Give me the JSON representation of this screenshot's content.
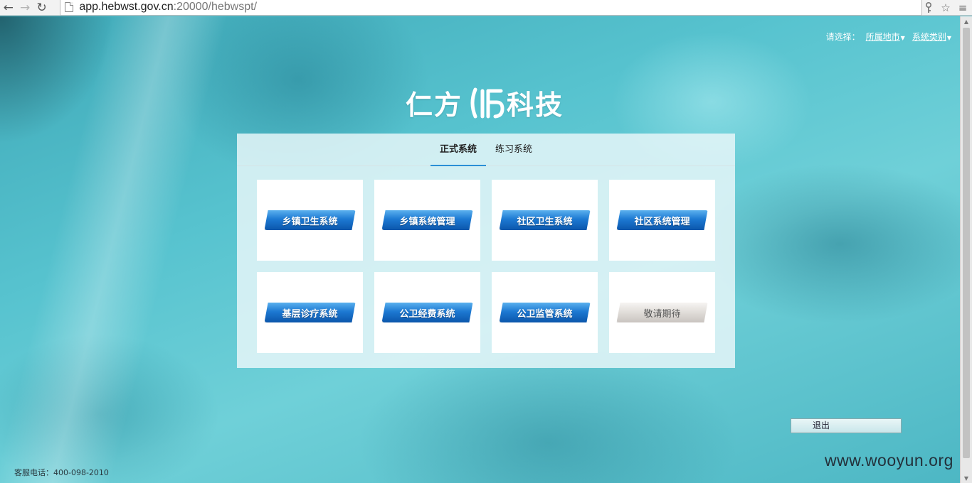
{
  "browser": {
    "url_host": "app.hebwst.gov.cn",
    "url_rest": ":20000/hebwspt/"
  },
  "selector": {
    "label": "请选择：",
    "city_dropdown": "所属地市",
    "category_dropdown": "系统类别"
  },
  "logo": {
    "text_left": "仁方",
    "text_right": "科技"
  },
  "tabs": [
    {
      "label": "正式系统",
      "active": true
    },
    {
      "label": "练习系统",
      "active": false
    }
  ],
  "systems": [
    {
      "label": "乡镇卫生系统",
      "enabled": true
    },
    {
      "label": "乡镇系统管理",
      "enabled": true
    },
    {
      "label": "社区卫生系统",
      "enabled": true
    },
    {
      "label": "社区系统管理",
      "enabled": true
    },
    {
      "label": "基层诊疗系统",
      "enabled": true
    },
    {
      "label": "公卫经费系统",
      "enabled": true
    },
    {
      "label": "公卫监管系统",
      "enabled": true
    },
    {
      "label": "敬请期待",
      "enabled": false
    }
  ],
  "logout_label": "退出",
  "hotline": "客服电话：400-098-2010",
  "watermark": "www.wooyun.org",
  "colors": {
    "accent_blue": "#1d79d2",
    "tab_underline": "#2b8fd6",
    "background_teal": "#57c3cf"
  }
}
